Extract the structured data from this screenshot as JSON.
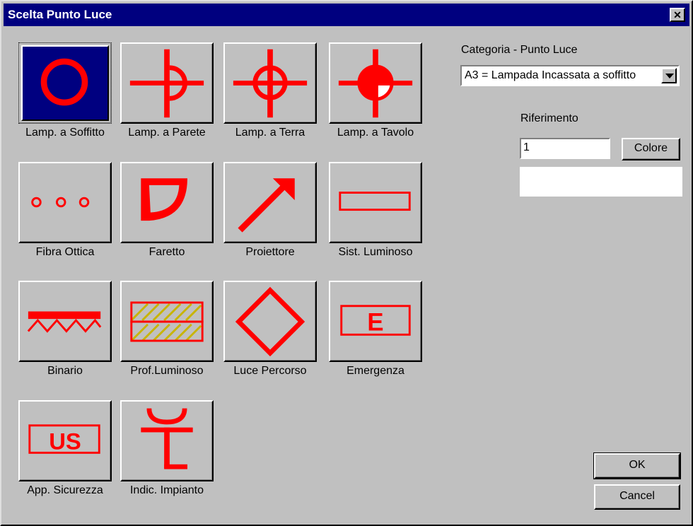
{
  "window": {
    "title": "Scelta Punto Luce",
    "close_symbol": "✕"
  },
  "symbols": [
    {
      "label": "Lamp. a Soffitto",
      "icon": "ceiling-lamp-icon",
      "selected": true
    },
    {
      "label": "Lamp. a Parete",
      "icon": "wall-lamp-icon",
      "selected": false
    },
    {
      "label": "Lamp. a Terra",
      "icon": "floor-lamp-icon",
      "selected": false
    },
    {
      "label": "Lamp. a Tavolo",
      "icon": "table-lamp-icon",
      "selected": false
    },
    {
      "label": "Fibra Ottica",
      "icon": "fiber-optic-icon",
      "selected": false
    },
    {
      "label": "Faretto",
      "icon": "spotlight-icon",
      "selected": false
    },
    {
      "label": "Proiettore",
      "icon": "projector-icon",
      "selected": false
    },
    {
      "label": "Sist. Luminoso",
      "icon": "light-system-icon",
      "selected": false
    },
    {
      "label": "Binario",
      "icon": "track-icon",
      "selected": false
    },
    {
      "label": "Prof.Luminoso",
      "icon": "light-profile-icon",
      "selected": false
    },
    {
      "label": "Luce Percorso",
      "icon": "path-light-icon",
      "selected": false
    },
    {
      "label": "Emergenza",
      "icon": "emergency-icon",
      "selected": false
    },
    {
      "label": "App. Sicurezza",
      "icon": "safety-device-icon",
      "selected": false
    },
    {
      "label": "Indic. Impianto",
      "icon": "system-indicator-icon",
      "selected": false
    }
  ],
  "icon_letters": {
    "emergency": "E",
    "safety": "US"
  },
  "category": {
    "label": "Categoria - Punto Luce",
    "value": "A3 = Lampada Incassata a soffitto"
  },
  "reference": {
    "label": "Riferimento",
    "value": "1"
  },
  "buttons": {
    "color": "Colore",
    "ok": "OK",
    "cancel": "Cancel"
  },
  "colors": {
    "title_bar": "#00007f",
    "face": "#c0c0c0",
    "symbol": "#ff0000",
    "hatch": "#c8b400"
  }
}
